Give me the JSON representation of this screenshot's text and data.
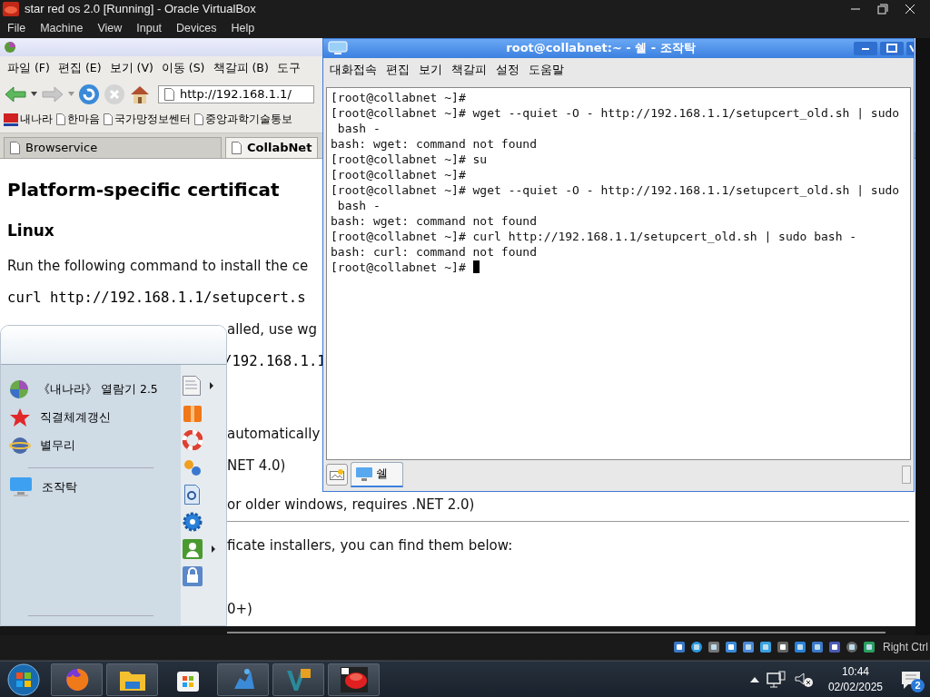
{
  "host_window": {
    "title": "star red os 2.0 [Running] - Oracle VirtualBox",
    "menu": [
      "File",
      "Machine",
      "View",
      "Input",
      "Devices",
      "Help"
    ]
  },
  "browser": {
    "menu": [
      "파일 (F)",
      "편집 (E)",
      "보기 (V)",
      "이동 (S)",
      "책갈피 (B)",
      "도구"
    ],
    "url": "http://192.168.1.1/",
    "bookmarks": [
      {
        "label": "내나라",
        "kind": "site"
      },
      {
        "label": "한마음",
        "kind": "page"
      },
      {
        "label": "국가망정보쎈터",
        "kind": "page"
      },
      {
        "label": "중앙과학기술통보",
        "kind": "page"
      }
    ],
    "tabs": [
      {
        "label": "Browservice",
        "selected": false
      },
      {
        "label": "CollabNet",
        "selected": true
      }
    ],
    "content": [
      {
        "kind": "heading",
        "text": "Platform-specific certificat"
      },
      {
        "kind": "subheading",
        "text": "Linux"
      },
      {
        "kind": "text",
        "text": "Run the following command to install the ce"
      },
      {
        "kind": "code",
        "text": "curl http://192.168.1.1/setupcert.s"
      },
      {
        "kind": "partial_text",
        "text": "alled, use wg"
      },
      {
        "kind": "partial_code",
        "text": "/192.168.1.1"
      },
      {
        "kind": "partial_text",
        "text": "automatically"
      },
      {
        "kind": "partial_text",
        "text": "NET 4.0)"
      },
      {
        "kind": "partial_text",
        "text": "or older windows, requires .NET 2.0)"
      },
      {
        "kind": "rule"
      },
      {
        "kind": "partial_text",
        "text": "ficate installers, you can find them below:"
      },
      {
        "kind": "partial_text",
        "text": "0+)"
      }
    ]
  },
  "terminal": {
    "title": "root@collabnet:~ - 쉘 - 조작탁",
    "menu": [
      "대화접속",
      "편집",
      "보기",
      "책갈피",
      "설정",
      "도움말"
    ],
    "lines": [
      "[root@collabnet ~]#",
      "[root@collabnet ~]# wget --quiet -O - http://192.168.1.1/setupcert_old.sh | sudo",
      " bash -",
      "bash: wget: command not found",
      "[root@collabnet ~]# su",
      "[root@collabnet ~]#",
      "[root@collabnet ~]# wget --quiet -O - http://192.168.1.1/setupcert_old.sh | sudo",
      " bash -",
      "bash: wget: command not found",
      "[root@collabnet ~]# curl http://192.168.1.1/setupcert_old.sh | sudo bash -",
      "bash: curl: command not found",
      "[root@collabnet ~]# "
    ],
    "cursor_visible": true,
    "tabs": [
      {
        "label": "쉘",
        "selected": true
      }
    ]
  },
  "start_menu": {
    "items": [
      {
        "label": "《내나라》 열람기 2.5",
        "separator_before": false
      },
      {
        "label": "직결체계갱신",
        "separator_before": false
      },
      {
        "label": "별무리",
        "separator_before": false
      },
      {
        "label": "조작탁",
        "separator_before": true
      }
    ],
    "side_items": [
      {
        "submenu": true
      },
      {
        "submenu": false
      },
      {
        "submenu": false
      },
      {
        "submenu": false
      },
      {
        "submenu": false
      },
      {
        "submenu": false
      },
      {
        "submenu": true
      },
      {
        "submenu": false
      }
    ]
  },
  "status_bar": {
    "host_key": "Right Ctrl"
  },
  "taskbar": {
    "apps": [
      {
        "running": true
      },
      {
        "running": true
      },
      {
        "running": false
      },
      {
        "running": true
      },
      {
        "running": true
      },
      {
        "running": true
      }
    ],
    "time": "10:44",
    "date": "02/02/2025",
    "notifications": "2"
  }
}
